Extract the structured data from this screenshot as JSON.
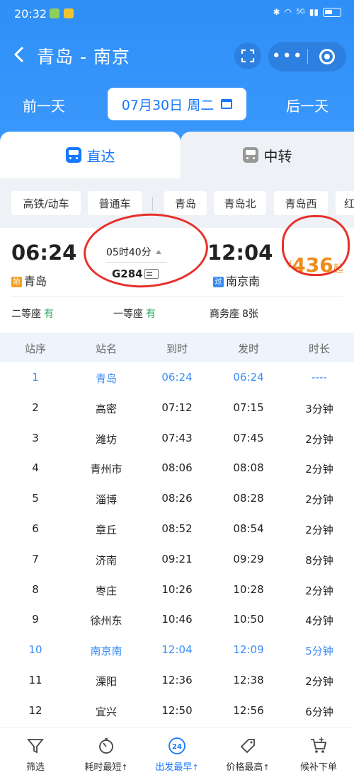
{
  "status_bar": {
    "time": "20:32",
    "network": "5G"
  },
  "header": {
    "route": "青岛 - 南京"
  },
  "date_bar": {
    "prev": "前一天",
    "date": "07月30日 周二",
    "next": "后一天"
  },
  "tabs": [
    {
      "label": "直达"
    },
    {
      "label": "中转"
    }
  ],
  "filters": [
    "高铁/动车",
    "普通车",
    "青岛",
    "青岛北",
    "青岛西",
    "红"
  ],
  "train": {
    "dep_time": "06:24",
    "dep_tag": "始",
    "dep_station": "青岛",
    "arr_time": "12:04",
    "arr_tag": "过",
    "arr_station": "南京南",
    "duration": "05时40分",
    "number": "G284",
    "price_symbol": "¥",
    "price": "436",
    "price_suffix": "起",
    "seats": [
      {
        "name": "二等座",
        "status": "有"
      },
      {
        "name": "一等座",
        "status": "有"
      },
      {
        "name": "商务座",
        "status": "8张"
      }
    ]
  },
  "table": {
    "headers": [
      "站序",
      "站名",
      "到时",
      "发时",
      "时长"
    ],
    "rows": [
      {
        "seq": "1",
        "station": "青岛",
        "arrive": "06:24",
        "depart": "06:24",
        "stay": "----",
        "highlight": true
      },
      {
        "seq": "2",
        "station": "高密",
        "arrive": "07:12",
        "depart": "07:15",
        "stay": "3分钟"
      },
      {
        "seq": "3",
        "station": "潍坊",
        "arrive": "07:43",
        "depart": "07:45",
        "stay": "2分钟"
      },
      {
        "seq": "4",
        "station": "青州市",
        "arrive": "08:06",
        "depart": "08:08",
        "stay": "2分钟"
      },
      {
        "seq": "5",
        "station": "淄博",
        "arrive": "08:26",
        "depart": "08:28",
        "stay": "2分钟"
      },
      {
        "seq": "6",
        "station": "章丘",
        "arrive": "08:52",
        "depart": "08:54",
        "stay": "2分钟"
      },
      {
        "seq": "7",
        "station": "济南",
        "arrive": "09:21",
        "depart": "09:29",
        "stay": "8分钟"
      },
      {
        "seq": "8",
        "station": "枣庄",
        "arrive": "10:26",
        "depart": "10:28",
        "stay": "2分钟"
      },
      {
        "seq": "9",
        "station": "徐州东",
        "arrive": "10:46",
        "depart": "10:50",
        "stay": "4分钟"
      },
      {
        "seq": "10",
        "station": "南京南",
        "arrive": "12:04",
        "depart": "12:09",
        "stay": "5分钟",
        "highlight": true
      },
      {
        "seq": "11",
        "station": "溧阳",
        "arrive": "12:36",
        "depart": "12:38",
        "stay": "2分钟"
      },
      {
        "seq": "12",
        "station": "宜兴",
        "arrive": "12:50",
        "depart": "12:56",
        "stay": "6分钟"
      }
    ]
  },
  "bottom_nav": [
    {
      "label": "筛选",
      "icon": "filter-icon"
    },
    {
      "label": "耗时最短",
      "icon": "stopwatch-icon",
      "sort": "↑"
    },
    {
      "label": "出发最早",
      "icon": "clock-24-icon",
      "sort": "↑",
      "active": true
    },
    {
      "label": "价格最高",
      "icon": "price-tag-icon",
      "sort": "↑"
    },
    {
      "label": "候补下单",
      "icon": "cart-plus-icon"
    }
  ],
  "colors": {
    "primary": "#1677ff",
    "header_bg": "#3a98fb",
    "price": "#f08a1a",
    "available": "#26a65b",
    "annotation": "#e8302a"
  }
}
